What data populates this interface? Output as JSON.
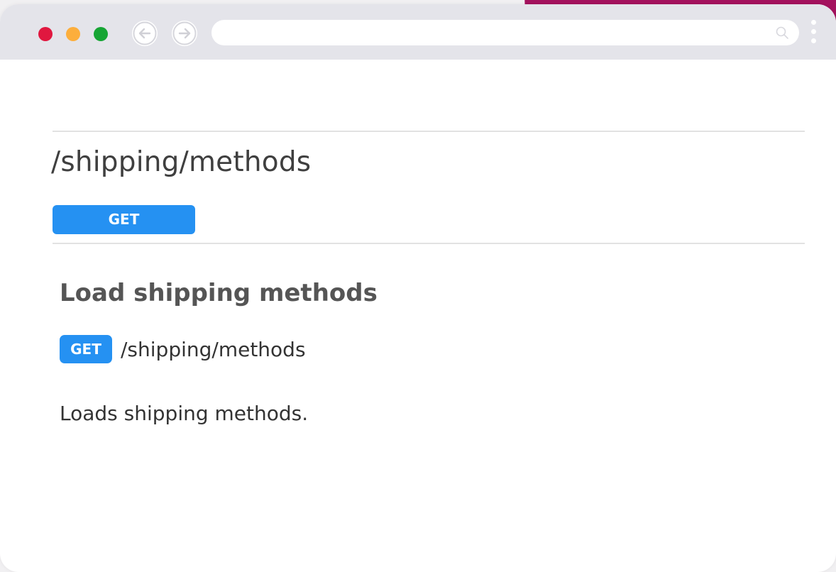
{
  "browser": {
    "window_controls": [
      {
        "name": "close",
        "color": "#e0173f"
      },
      {
        "name": "minimize",
        "color": "#fcae3c"
      },
      {
        "name": "maximize",
        "color": "#16a534"
      }
    ],
    "nav": {
      "back_icon": "arrow-left-icon",
      "forward_icon": "arrow-right-icon"
    },
    "address_bar": {
      "value": "",
      "icon": "search-icon"
    },
    "menu_icon": "more-vertical-icon"
  },
  "endpoint": {
    "path": "/shipping/methods",
    "method": "GET",
    "method_color": "#2591f2"
  },
  "operation": {
    "title": "Load shipping methods",
    "method": "GET",
    "path": "/shipping/methods",
    "description": "Loads shipping methods."
  },
  "colors": {
    "accent_background": "#a4125e",
    "toolbar": "#e4e4ea"
  }
}
